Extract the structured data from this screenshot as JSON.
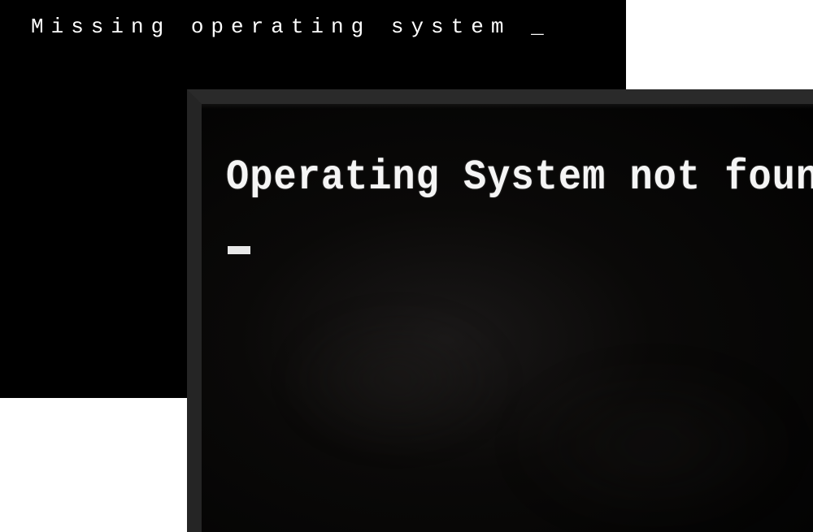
{
  "bios_screen_1": {
    "error_message": "Missing operating system ",
    "cursor": "_"
  },
  "bios_screen_2": {
    "error_message": "Operating System not found"
  }
}
